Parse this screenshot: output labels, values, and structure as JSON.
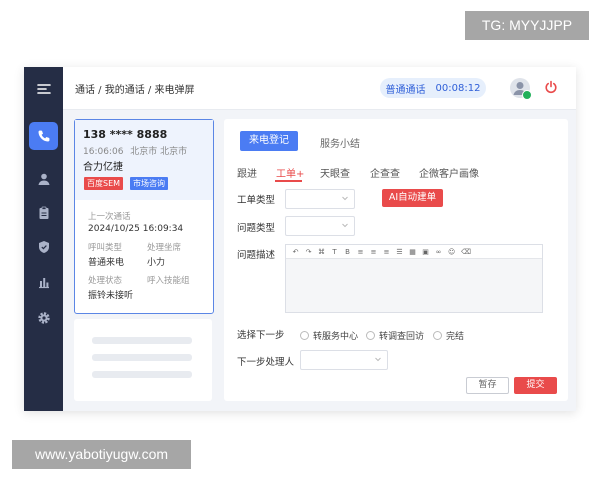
{
  "watermarks": {
    "top": "TG: MYYJJPP",
    "bottom": "www.yabotiyugw.com"
  },
  "sidebar": {
    "icons": [
      "menu-icon",
      "phone-icon",
      "user-icon",
      "clipboard-icon",
      "shield-icon",
      "bar-chart-icon",
      "gear-icon"
    ],
    "active": "phone-icon"
  },
  "header": {
    "breadcrumb": "通话 / 我的通话 / 来电弹屏",
    "call_type": "普通通话",
    "timer": "00:08:12"
  },
  "caller_card": {
    "phone": "138 **** 8888",
    "time": "16:06:06",
    "location": "北京市 北京市",
    "company": "合力亿捷",
    "tags": [
      "百度SEM",
      "市场咨询"
    ],
    "last_call_label": "上一次通话",
    "last_call_value": "2024/10/25  16:09:34",
    "call_type_label": "呼叫类型",
    "call_type_value": "普通来电",
    "handler_label": "处理坐席",
    "handler_value": "小力",
    "status_label": "处理状态",
    "status_value": "振铃未接听",
    "skill_group_label": "呼入技能组",
    "skill_group_value": ""
  },
  "main": {
    "segments": [
      "来电登记",
      "服务小结"
    ],
    "tabs": [
      "跟进",
      "工单+",
      "天眼查",
      "企查查",
      "企微客户画像"
    ],
    "active_tab": "工单+",
    "form": {
      "ticket_type_label": "工单类型",
      "ai_button": "AI自动建单",
      "problem_type_label": "问题类型",
      "problem_desc_label": "问题描述",
      "next_step_label": "选择下一步",
      "next_step_options": [
        "转服务中心",
        "转调查回访",
        "完结"
      ],
      "next_handler_label": "下一步处理人"
    },
    "editor_toolbar": [
      "undo-icon",
      "redo-icon",
      "format-painter-icon",
      "text-icon",
      "bold-icon",
      "align-left-icon",
      "align-center-icon",
      "align-right-icon",
      "list-icon",
      "table-icon",
      "image-icon",
      "link-icon",
      "emoji-icon",
      "delete-icon"
    ],
    "buttons": {
      "save": "暂存",
      "submit": "提交"
    }
  },
  "colors": {
    "sidebar": "#252d45",
    "accent": "#4b7cf3",
    "danger": "#e94b4b"
  }
}
